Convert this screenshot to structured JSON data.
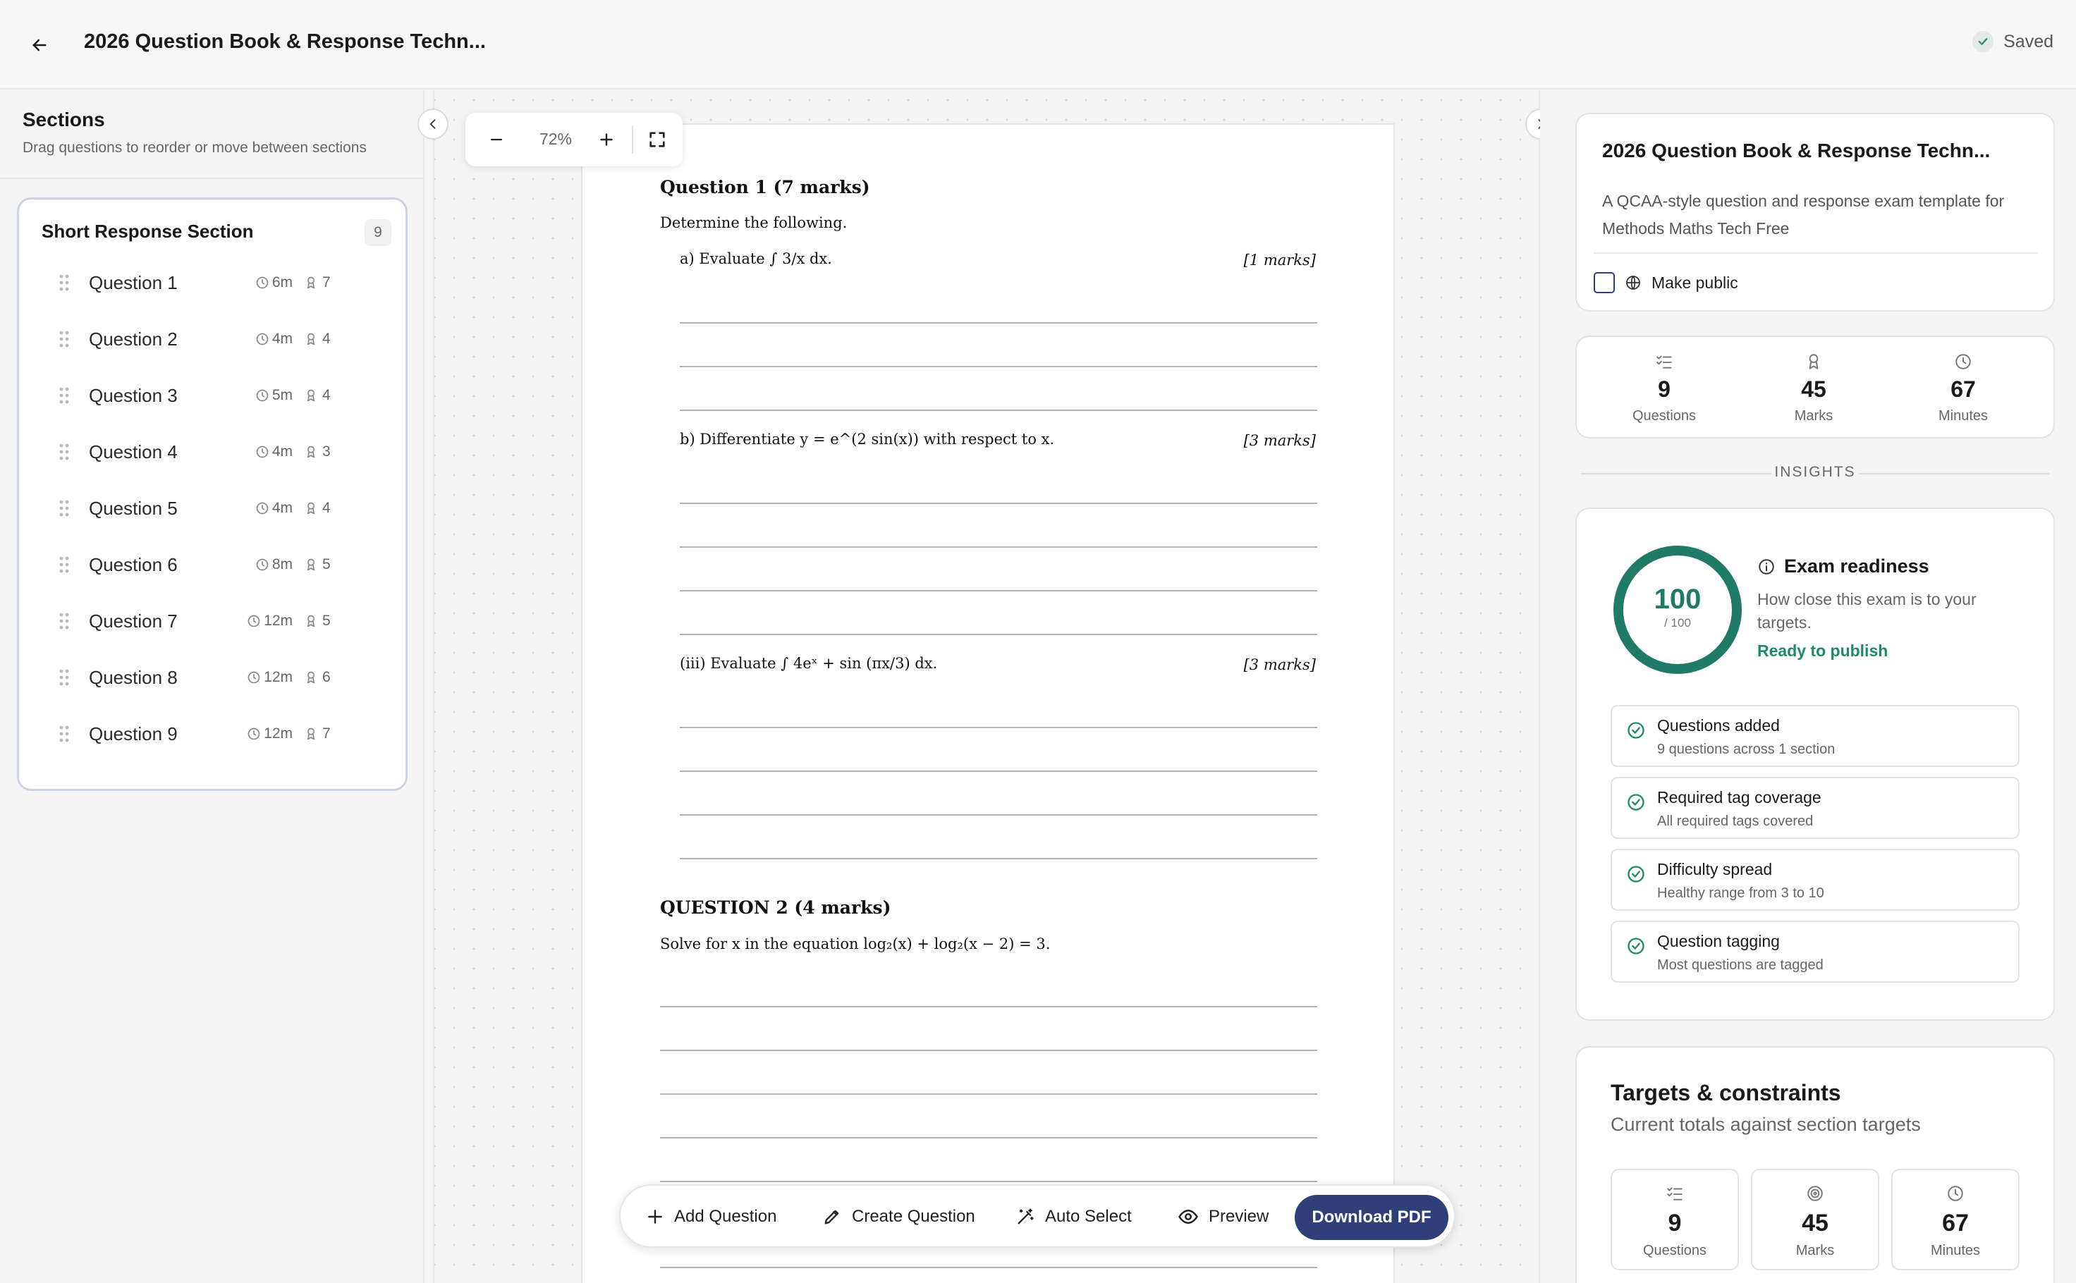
{
  "header": {
    "title": "2026 Question Book & Response Techn...",
    "saved_label": "Saved"
  },
  "sidebar": {
    "title": "Sections",
    "subtitle": "Drag questions to reorder or move between sections",
    "section": {
      "name": "Short Response Section",
      "count": "9",
      "questions": [
        {
          "label": "Question 1",
          "time": "6m",
          "marks": "7"
        },
        {
          "label": "Question 2",
          "time": "4m",
          "marks": "4"
        },
        {
          "label": "Question 3",
          "time": "5m",
          "marks": "4"
        },
        {
          "label": "Question 4",
          "time": "4m",
          "marks": "3"
        },
        {
          "label": "Question 5",
          "time": "4m",
          "marks": "4"
        },
        {
          "label": "Question 6",
          "time": "8m",
          "marks": "5"
        },
        {
          "label": "Question 7",
          "time": "12m",
          "marks": "5"
        },
        {
          "label": "Question 8",
          "time": "12m",
          "marks": "6"
        },
        {
          "label": "Question 9",
          "time": "12m",
          "marks": "7"
        }
      ]
    }
  },
  "zoom": {
    "value": "72%"
  },
  "paper": {
    "q1_heading": "Question 1  (7 marks)",
    "q1_intro": "Determine the following.",
    "part_a": "a)   Evaluate ∫ 3/x dx.",
    "part_a_marks": "[1 marks]",
    "part_b": "b)   Differentiate y = e^(2 sin(x)) with respect to x.",
    "part_b_marks": "[3 marks]",
    "part_c": "(iii) Evaluate ∫ 4eˣ + sin (πx/3) dx.",
    "part_c_marks": "[3 marks]",
    "q2_heading": "QUESTION 2  (4 marks)",
    "q2_text": "Solve for x in the equation log₂(x) + log₂(x − 2) = 3."
  },
  "toolbar": {
    "add_question": "Add Question",
    "create_question": "Create Question",
    "auto_select": "Auto Select",
    "preview": "Preview",
    "download_pdf": "Download PDF"
  },
  "details": {
    "title": "2026 Question Book & Response Techn...",
    "description": "A QCAA-style question and response exam template for Methods Maths Tech Free",
    "make_public": "Make public",
    "stats": [
      {
        "value": "9",
        "label": "Questions",
        "icon": "checklist-icon"
      },
      {
        "value": "45",
        "label": "Marks",
        "icon": "award-icon"
      },
      {
        "value": "67",
        "label": "Minutes",
        "icon": "clock-icon"
      }
    ]
  },
  "insights": {
    "label": "INSIGHTS",
    "score": "100",
    "score_max": "/ 100",
    "score_fraction": 1.0,
    "readiness_title": "Exam readiness",
    "readiness_desc": "How close this exam is to your targets.",
    "readiness_status": "Ready to publish",
    "checks": [
      {
        "title": "Questions added",
        "subtitle": "9 questions across 1 section"
      },
      {
        "title": "Required tag coverage",
        "subtitle": "All required tags covered"
      },
      {
        "title": "Difficulty spread",
        "subtitle": "Healthy range from 3 to 10"
      },
      {
        "title": "Question tagging",
        "subtitle": "Most questions are tagged"
      }
    ]
  },
  "targets": {
    "title": "Targets & constraints",
    "subtitle": "Current totals against section targets",
    "items": [
      {
        "value": "9",
        "label": "Questions",
        "icon": "checklist-icon"
      },
      {
        "value": "45",
        "label": "Marks",
        "icon": "target-icon"
      },
      {
        "value": "67",
        "label": "Minutes",
        "icon": "clock-icon"
      }
    ]
  },
  "colors": {
    "accent": "#2e3f79",
    "success": "#1f7a66",
    "section_border": "#ccd4e3"
  }
}
